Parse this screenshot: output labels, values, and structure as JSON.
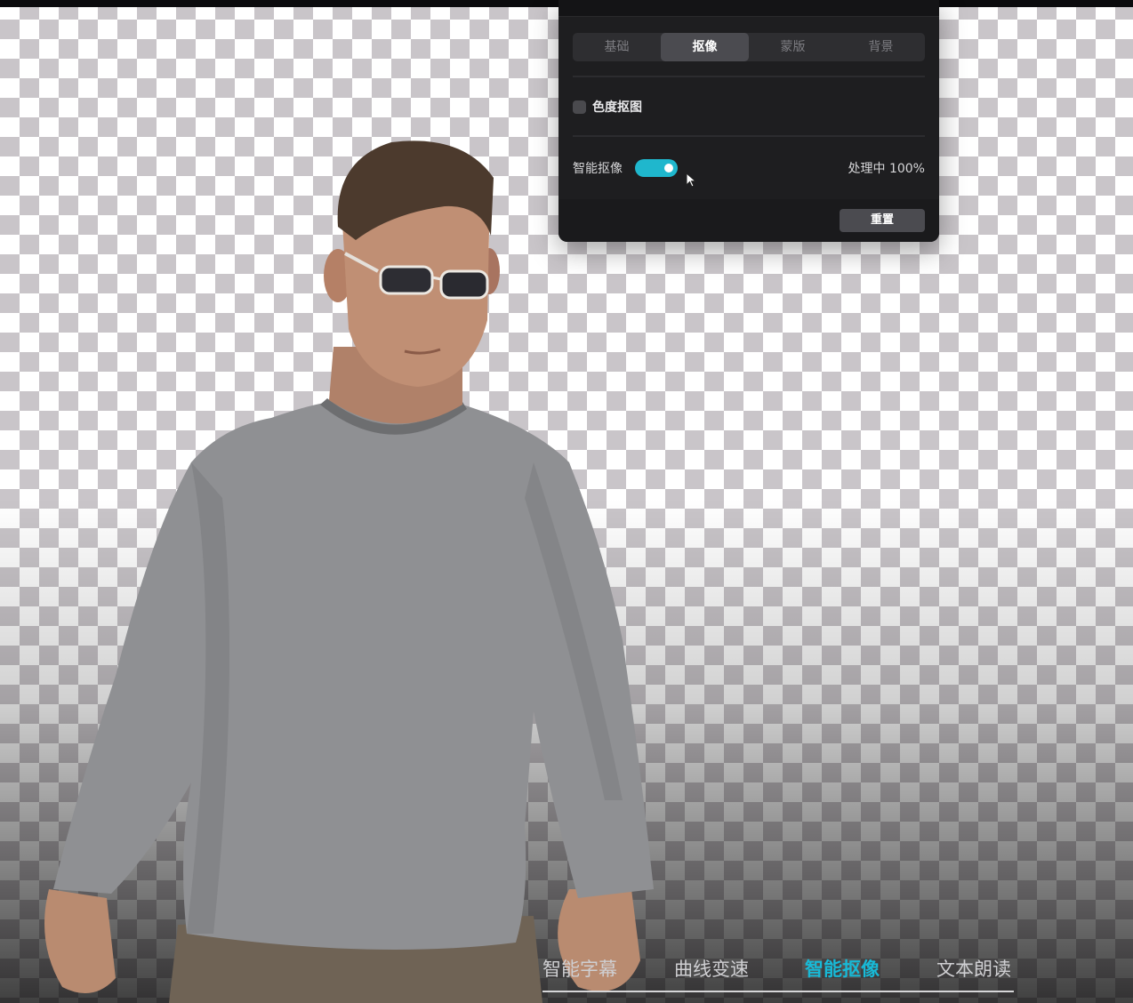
{
  "panel": {
    "tabs": [
      {
        "label": "基础",
        "active": false
      },
      {
        "label": "抠像",
        "active": true
      },
      {
        "label": "蒙版",
        "active": false
      },
      {
        "label": "背景",
        "active": false
      }
    ],
    "chroma_key": {
      "label": "色度抠图",
      "checked": false
    },
    "smart_cutout": {
      "label": "智能抠像",
      "enabled": true,
      "status": "处理中 100%"
    },
    "reset_label": "重置"
  },
  "bottom_nav": {
    "items": [
      {
        "label": "智能字幕",
        "active": false
      },
      {
        "label": "曲线变速",
        "active": false
      },
      {
        "label": "智能抠像",
        "active": true
      },
      {
        "label": "文本朗读",
        "active": false
      }
    ]
  },
  "colors": {
    "accent": "#1fb7cd",
    "panel_bg": "#1e1e20",
    "checker": "#c9c5c9"
  }
}
